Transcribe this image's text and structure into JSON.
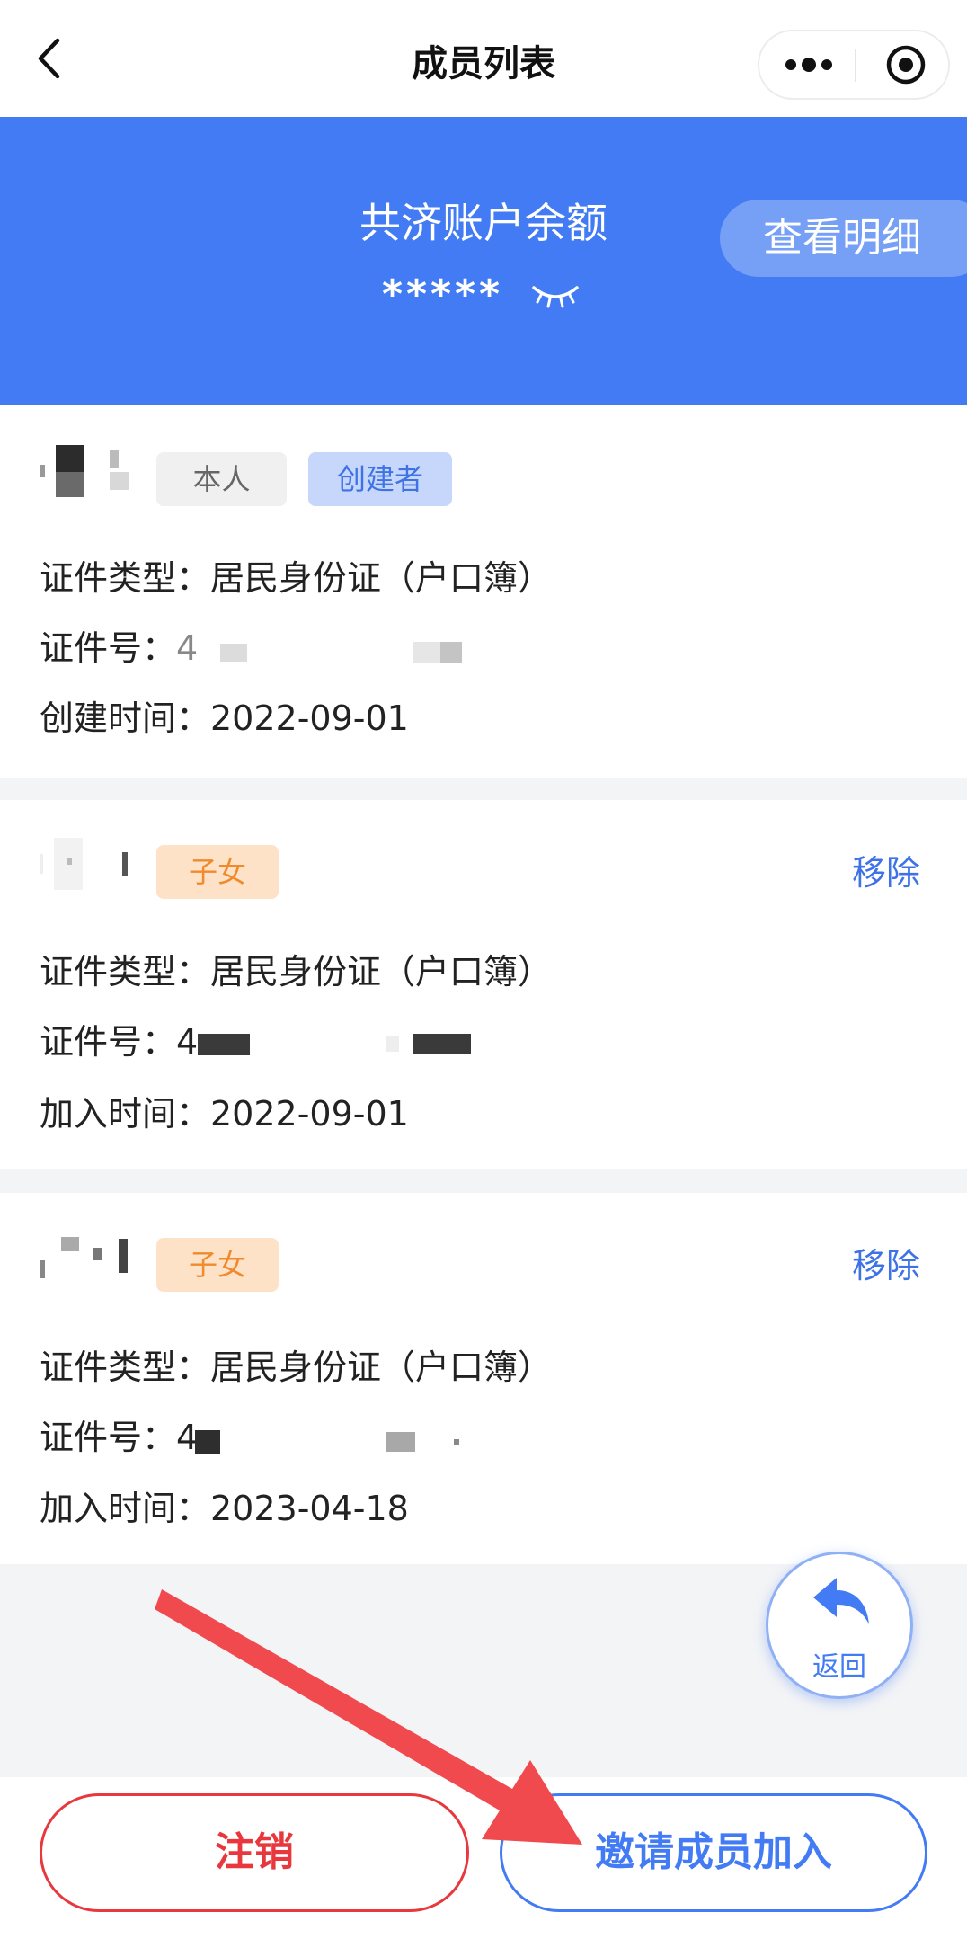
{
  "navbar": {
    "title": "成员列表"
  },
  "banner": {
    "title": "共济账户余额",
    "amount": "*****",
    "detail_label": "查看明细"
  },
  "members": [
    {
      "tags": [
        "本人",
        "创建者"
      ],
      "id_type_label": "证件类型：居民身份证（户口簿）",
      "id_no_label": "证件号：",
      "id_no_prefix": "4",
      "time_label": "创建时间：2022-09-01"
    },
    {
      "tags": [
        "子女"
      ],
      "remove_label": "移除",
      "id_type_label": "证件类型：居民身份证（户口簿）",
      "id_no_label": "证件号：",
      "id_no_prefix": "4",
      "time_label": "加入时间：2022-09-01"
    },
    {
      "tags": [
        "子女"
      ],
      "remove_label": "移除",
      "id_type_label": "证件类型：居民身份证（户口簿）",
      "id_no_label": "证件号：",
      "id_no_prefix": "4",
      "time_label": "加入时间：2023-04-18"
    }
  ],
  "float_button": {
    "label": "返回"
  },
  "bottom": {
    "cancel_label": "注销",
    "invite_label": "邀请成员加入"
  },
  "colors": {
    "primary": "#427bf3",
    "danger": "#e8383d",
    "child_tag": "#f08a2c",
    "annotation_arrow": "#f04a4f"
  },
  "icons": [
    "back-chevron-icon",
    "more-dots-icon",
    "close-target-icon",
    "eye-closed-icon",
    "return-arrow-icon"
  ]
}
